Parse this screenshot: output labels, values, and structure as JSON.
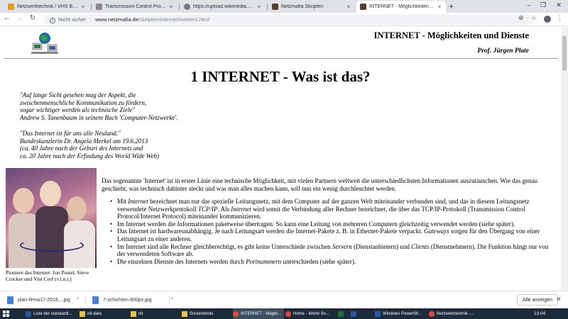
{
  "browser": {
    "tabs": [
      {
        "label": "Netzwerktechnik / VHS BS / 11.",
        "favicon_color": "#f29900"
      },
      {
        "label": "Transmission Control Protocol -",
        "favicon_color": "#888888"
      },
      {
        "label": "https://upload.wikimedia.org/wi",
        "favicon_color": "#777777"
      },
      {
        "label": "Netzmafia Skripten",
        "favicon_color": "#5a3a2a"
      },
      {
        "label": "INTERNET - Möglichkeiten und D",
        "favicon_color": "#5a3a2a"
      }
    ],
    "new_tab_label": "+",
    "security_label": "Nicht sicher",
    "url_host": "www.netzmafia.de",
    "url_path": "/skripten/internet/inetein1.html"
  },
  "page": {
    "header_title": "INTERNET - Möglichkeiten und Dienste",
    "header_author": "Prof. Jürgen Plate",
    "heading": "1 INTERNET - Was ist das?",
    "quote1": [
      "\"Auf lange Sicht gesehen mag der Aspekt, die",
      "zwischenmenschliche Kommunikation zu fördern,",
      "sogar wichtiger werden als technische Ziele\"",
      "Andrew S. Tanenbaum in seinem Buch 'Computer-Netzwerke'."
    ],
    "quote2": [
      "\"Das Internet ist für uns alle Neuland.\"",
      "Bundeskanzlerin Dr. Angela Merkel am 19.6.2013",
      "(ca. 40 Jahre nach der Geburt des Internets und",
      "ca. 20 Jahre nach der Erfindung des World Wide Web)"
    ],
    "photo_caption": "Pioniere des Internet: Jon Postel, Steve Crocker und Vint Cerf (v.l.n.r.)",
    "intro": "Das sogenannte 'Internet' ist in erster Linie eine technische Möglichkeit, mit vielen Partnern weltweit die unterschiedlichsten Informationen auszutauschen. Wie das genau geschieht, was technisch dahinter steckt und was man alles machen kann, soll nun ein wenig durchleuchtet werden.",
    "bullets": [
      {
        "pre": "Mit ",
        "em1": "Internet",
        "mid1": " bezeichnet man nur das spezielle Leitungsnetz, mit dem Computer auf der ganzen Welt miteinander verbunden sind, und das in diesem Leitungsnetz verwendete Netzwerkprotokoll ",
        "em2": "TCP/IP",
        "mid2": ". Als ",
        "em3": "Internet",
        "post": " wird somit die Verbindung aller Rechner bezeichnet, die über das TCP/IP-Protokoll (Transmission Control Protocol/Internet Protocol) miteinander kommunizieren."
      },
      {
        "text": "Im Internet werden die Informationen paketweise übertragen. So kann eine Leitung von mehreren Computern gleichzeitig verwendet werden (siehe später)."
      },
      {
        "pre": "Das Internet ist hardwareunabhängig. Je nach Leitungsart werden die Internet-Pakete z. B. in Ethernet-Pakete verpackt. ",
        "em1": "Gateways",
        "post": " sorgen für den Übergang von einer Leitungsart zu einer anderen."
      },
      {
        "pre": "Im Internet sind alle Rechner gleichberechtigt, es gibt keine Unterschiede zwischen ",
        "em1": "Servern",
        "mid1": " (Dienstanbietern) und ",
        "em2": "Clients",
        "post": " (Dienstnehmern). Die Funktion hängt nur von der verwendeten Software ab."
      },
      {
        "pre": "Die einzelnen Dienste des Internets werden durch ",
        "em1": "Portnummern",
        "post": " unterschieden (siehe später)."
      }
    ]
  },
  "downloads": {
    "items": [
      "plan-firma17-2018....jpg",
      "7-schichten-800px.jpg"
    ],
    "show_all": "Alle anzeigen"
  },
  "taskbar": {
    "items": [
      {
        "label": "Liste der standardi...",
        "color": "#2b579a"
      },
      {
        "label": "nit-data",
        "color": "#f0c040"
      },
      {
        "label": "nit",
        "color": "#f0c040"
      },
      {
        "label": "Screenshots",
        "color": "#f0c040"
      },
      {
        "label": "INTERNET - Möglic...",
        "color": "#e8453c"
      },
      {
        "label": "Home - World Sn...",
        "color": "#e8453c"
      },
      {
        "label": "",
        "color": "#1d6f42"
      },
      {
        "label": "",
        "color": "#2b579a"
      },
      {
        "label": "Windows PowerSh...",
        "color": "#2a5aa8"
      },
      {
        "label": "Netzwerktechnik -...",
        "color": "#e8453c"
      }
    ],
    "time": "13:04"
  }
}
